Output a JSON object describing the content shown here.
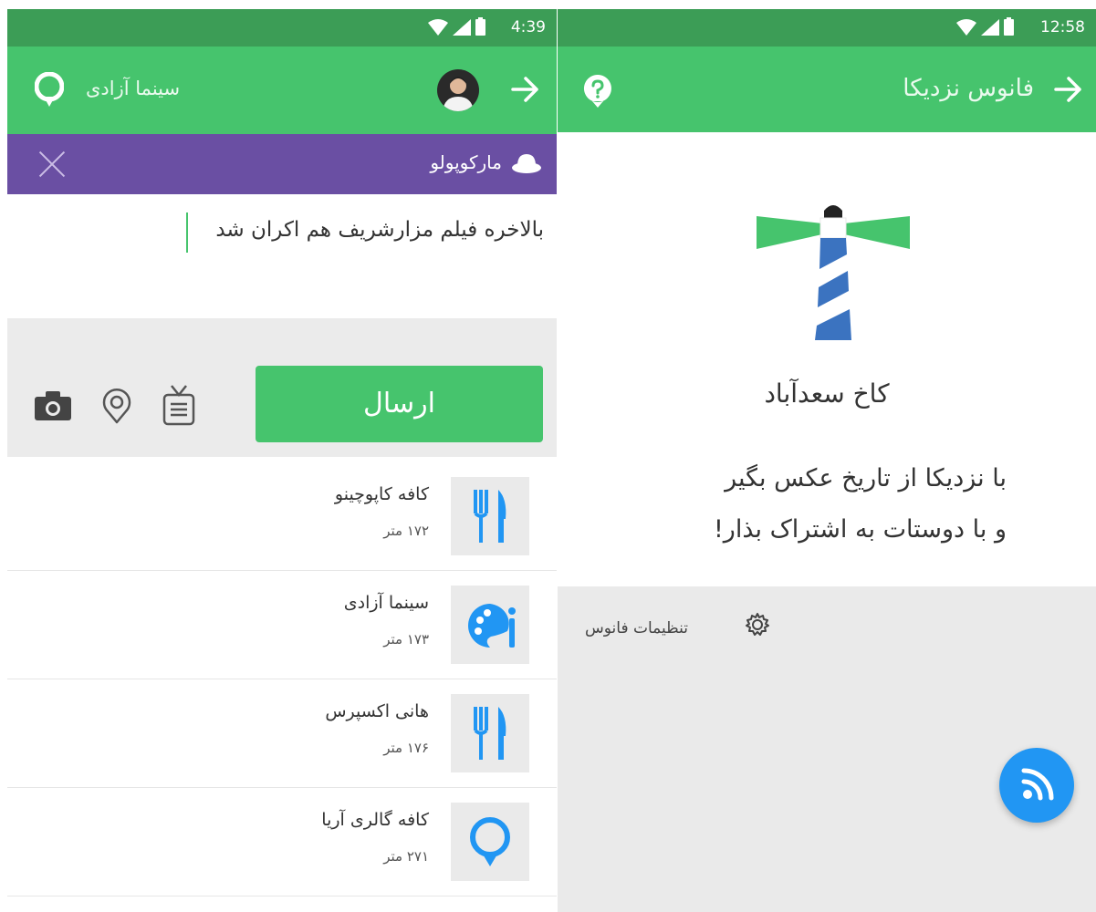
{
  "left": {
    "status_time": "4:39",
    "header_title": "سینما آزادی",
    "banner_label": "مارکوپولو",
    "compose_text": "بالاخره فیلم مزارشریف هم اکران شد",
    "send_label": "ارسال",
    "places": [
      {
        "name": "کافه کاپوچینو",
        "distance": "۱۷۲ متر",
        "icon": "fork-knife-icon"
      },
      {
        "name": "سینما آزادی",
        "distance": "۱۷۳ متر",
        "icon": "palette-icon"
      },
      {
        "name": "هانی اکسپرس",
        "distance": "۱۷۶ متر",
        "icon": "fork-knife-icon"
      },
      {
        "name": "کافه گالری آریا",
        "distance": "۲۷۱ متر",
        "icon": "location-marker-icon"
      }
    ]
  },
  "right": {
    "status_time": "12:58",
    "header_title": "فانوس نزدیکا",
    "place_name": "کاخ سعدآباد",
    "hero_line1": "با نزدیکا از تاریخ عکس بگیر",
    "hero_line2": "و با دوستات به اشتراک بذار!",
    "settings_label": "تنظیمات فانوس"
  },
  "colors": {
    "status_bar": "#3c9d56",
    "app_bar": "#46c46d",
    "banner": "#6a4fa3",
    "list_icon": "#2196f3",
    "fab": "#2196f3"
  }
}
